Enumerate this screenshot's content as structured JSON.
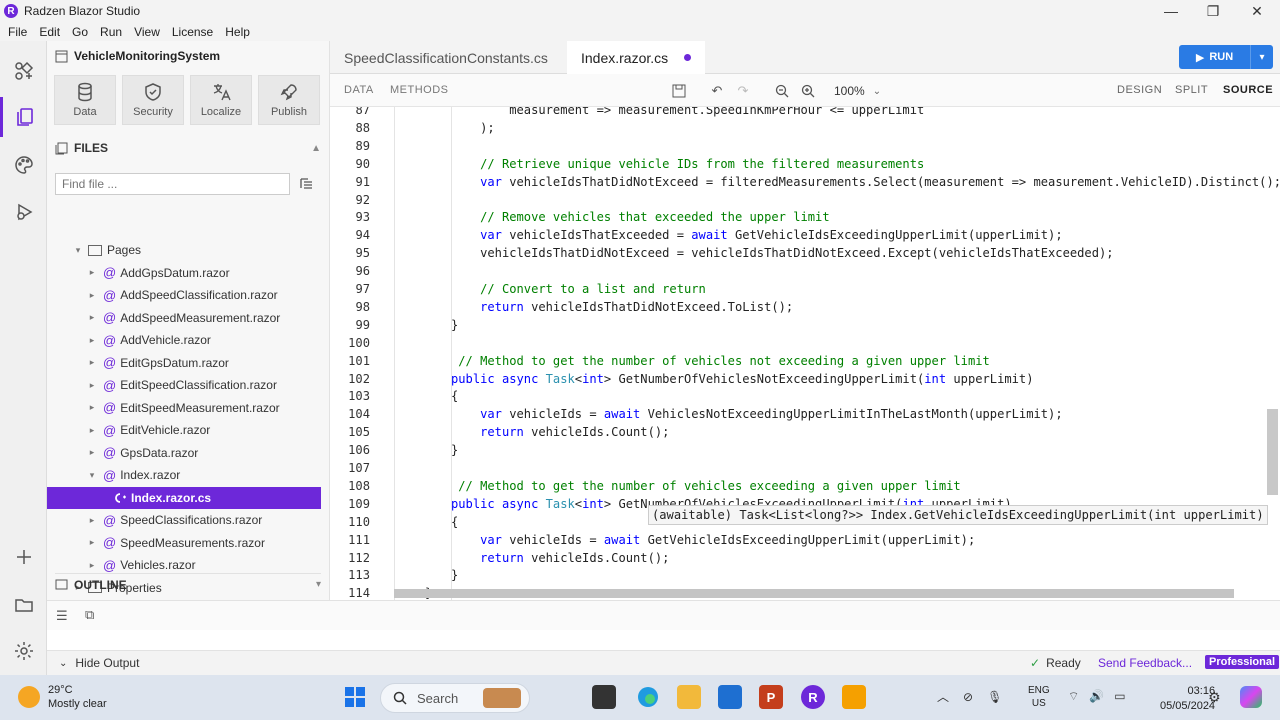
{
  "window": {
    "title": "Radzen Blazor Studio"
  },
  "menu": [
    "File",
    "Edit",
    "Go",
    "Run",
    "View",
    "License",
    "Help"
  ],
  "sidebar": {
    "project": "VehicleMonitoringSystem",
    "tools": [
      {
        "label": "Data",
        "icon": "database-icon"
      },
      {
        "label": "Security",
        "icon": "shield-icon"
      },
      {
        "label": "Localize",
        "icon": "translate-icon"
      },
      {
        "label": "Publish",
        "icon": "rocket-icon"
      }
    ],
    "files_header": "FILES",
    "find_placeholder": "Find file ...",
    "tree": [
      {
        "label": "Pages",
        "type": "folder",
        "level": 1,
        "expanded": true
      },
      {
        "label": "AddGpsDatum.razor",
        "type": "razor",
        "level": 2
      },
      {
        "label": "AddSpeedClassification.razor",
        "type": "razor",
        "level": 2
      },
      {
        "label": "AddSpeedMeasurement.razor",
        "type": "razor",
        "level": 2
      },
      {
        "label": "AddVehicle.razor",
        "type": "razor",
        "level": 2
      },
      {
        "label": "EditGpsDatum.razor",
        "type": "razor",
        "level": 2
      },
      {
        "label": "EditSpeedClassification.razor",
        "type": "razor",
        "level": 2
      },
      {
        "label": "EditSpeedMeasurement.razor",
        "type": "razor",
        "level": 2
      },
      {
        "label": "EditVehicle.razor",
        "type": "razor",
        "level": 2
      },
      {
        "label": "GpsData.razor",
        "type": "razor",
        "level": 2
      },
      {
        "label": "Index.razor",
        "type": "razor",
        "level": 2,
        "expanded": true
      },
      {
        "label": "Index.razor.cs",
        "type": "cs",
        "level": 3,
        "selected": true
      },
      {
        "label": "SpeedClassifications.razor",
        "type": "razor",
        "level": 2
      },
      {
        "label": "SpeedMeasurements.razor",
        "type": "razor",
        "level": 2
      },
      {
        "label": "Vehicles.razor",
        "type": "razor",
        "level": 2
      },
      {
        "label": "Properties",
        "type": "folder",
        "level": 1
      }
    ],
    "outline_header": "OUTLINE"
  },
  "tabs": [
    {
      "label": "SpeedClassificationConstants.cs",
      "active": false
    },
    {
      "label": "Index.razor.cs",
      "active": true,
      "modified": true
    }
  ],
  "run_label": "RUN",
  "toolbar": {
    "data": "DATA",
    "methods": "METHODS",
    "zoom": "100%",
    "modes": [
      "DESIGN",
      "SPLIT",
      "SOURCE"
    ],
    "active_mode": "SOURCE"
  },
  "code": [
    {
      "n": "87",
      "t": "            measurement => measurement.SpeedInKmPerHour <= upperLimit"
    },
    {
      "n": "88",
      "t": "        );"
    },
    {
      "n": "89",
      "t": ""
    },
    {
      "n": "90",
      "t": "        // Retrieve unique vehicle IDs from the filtered measurements"
    },
    {
      "n": "91",
      "t": "        var vehicleIdsThatDidNotExceed = filteredMeasurements.Select(measurement => measurement.VehicleID).Distinct();"
    },
    {
      "n": "92",
      "t": ""
    },
    {
      "n": "93",
      "t": "        // Remove vehicles that exceeded the upper limit"
    },
    {
      "n": "94",
      "t": "        var vehicleIdsThatExceeded = await GetVehicleIdsExceedingUpperLimit(upperLimit);"
    },
    {
      "n": "95",
      "t": "        vehicleIdsThatDidNotExceed = vehicleIdsThatDidNotExceed.Except(vehicleIdsThatExceeded);"
    },
    {
      "n": "96",
      "t": ""
    },
    {
      "n": "97",
      "t": "        // Convert to a list and return"
    },
    {
      "n": "98",
      "t": "        return vehicleIdsThatDidNotExceed.ToList();"
    },
    {
      "n": "99",
      "t": "    }"
    },
    {
      "n": "100",
      "t": ""
    },
    {
      "n": "101",
      "t": "     // Method to get the number of vehicles not exceeding a given upper limit"
    },
    {
      "n": "102",
      "t": "    public async Task<int> GetNumberOfVehiclesNotExceedingUpperLimit(int upperLimit)"
    },
    {
      "n": "103",
      "t": "    {"
    },
    {
      "n": "104",
      "t": "        var vehicleIds = await VehiclesNotExceedingUpperLimitInTheLastMonth(upperLimit);"
    },
    {
      "n": "105",
      "t": "        return vehicleIds.Count();"
    },
    {
      "n": "106",
      "t": "    }"
    },
    {
      "n": "107",
      "t": ""
    },
    {
      "n": "108",
      "t": "     // Method to get the number of vehicles exceeding a given upper limit"
    },
    {
      "n": "109",
      "t": "    public async Task<int> GetNumberOfVehiclesExceedingUpperLimit(int upperLimit)"
    },
    {
      "n": "110",
      "t": "    {"
    },
    {
      "n": "111",
      "t": "        var vehicleIds = await GetVehicleIdsExceedingUpperLimit(upperLimit);"
    },
    {
      "n": "112",
      "t": "        return vehicleIds.Count();"
    },
    {
      "n": "113",
      "t": "    }"
    },
    {
      "n": "114",
      "t": "}"
    }
  ],
  "tooltip": "(awaitable) Task<List<long?>> Index.GetVehicleIdsExceedingUpperLimit(int upperLimit)",
  "status": {
    "hide_output": "Hide Output",
    "ready": "Ready",
    "feedback": "Send Feedback...",
    "badge": "Professional"
  },
  "taskbar": {
    "temp": "29°C",
    "weather": "Mostly clear",
    "search": "Search",
    "lang1": "ENG",
    "lang2": "US",
    "time": "03:16",
    "date": "05/05/2024"
  },
  "colors": {
    "accent": "#6d28d9",
    "run": "#2a7be4",
    "keyword": "#0000ff",
    "type": "#2b91af",
    "comment": "#008000"
  }
}
